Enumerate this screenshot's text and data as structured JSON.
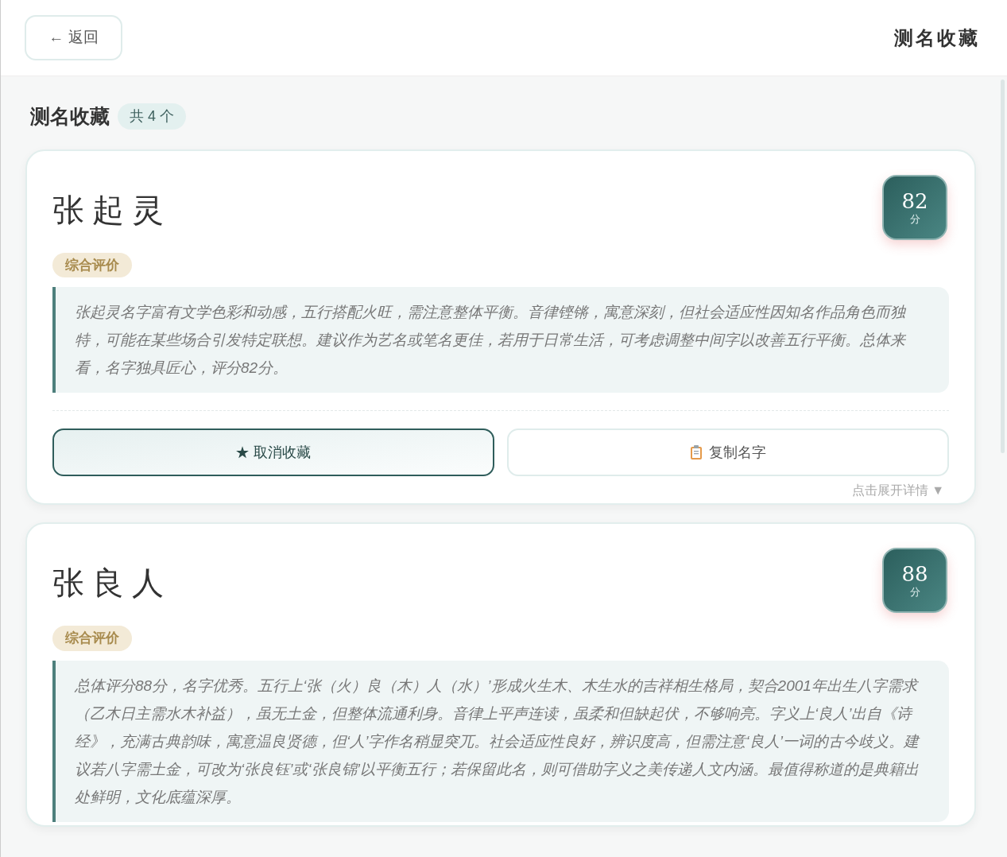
{
  "header": {
    "back_button": "← 返回",
    "title": "测名收藏"
  },
  "section": {
    "title": "测名收藏",
    "count_badge": "共 4 个"
  },
  "cards": [
    {
      "name": "张起灵",
      "score": "82",
      "score_unit": "分",
      "label": "综合评价",
      "comment": "张起灵名字富有文学色彩和动感，五行搭配火旺，需注意整体平衡。音律铿锵，寓意深刻，但社会适应性因知名作品角色而独特，可能在某些场合引发特定联想。建议作为艺名或笔名更佳，若用于日常生活，可考虑调整中间字以改善五行平衡。总体来看，名字独具匠心，评分82分。",
      "actions": [
        {
          "kind": "unfavorite",
          "label": "★ 取消收藏"
        },
        {
          "kind": "copy",
          "label": "复制名字"
        }
      ],
      "expand_hint": "点击展开详情 ▼"
    },
    {
      "name": "张良人",
      "score": "88",
      "score_unit": "分",
      "label": "综合评价",
      "comment": "总体评分88分，名字优秀。五行上‘张（火）良（木）人（水）’形成火生木、木生水的吉祥相生格局，契合2001年出生八字需求（乙木日主需水木补益），虽无土金，但整体流通利身。音律上平声连读，虽柔和但缺起伏，不够响亮。字义上‘良人’出自《诗经》，充满古典韵味，寓意温良贤德，但‘人’字作名稍显突兀。社会适应性良好，辨识度高，但需注意‘良人’一词的古今歧义。建议若八字需土金，可改为‘张良钰’或‘张良锦’以平衡五行；若保留此名，则可借助字义之美传递人文内涵。最值得称道的是典籍出处鲜明，文化底蕴深厚。"
    }
  ]
}
